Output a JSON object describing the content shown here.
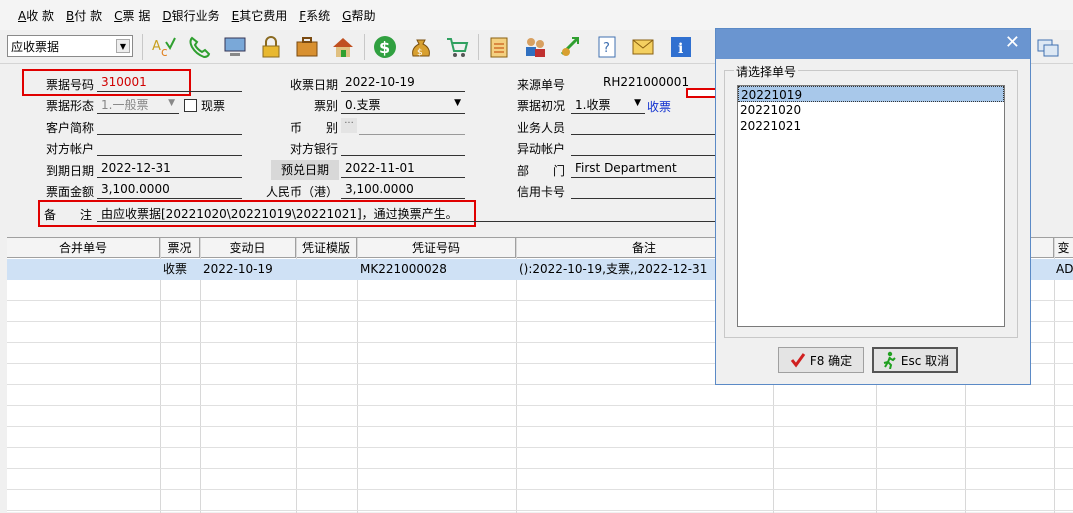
{
  "menu": [
    {
      "key": "A",
      "label": "收 款"
    },
    {
      "key": "B",
      "label": "付 款"
    },
    {
      "key": "C",
      "label": "票 据"
    },
    {
      "key": "D",
      "label": "银行业务"
    },
    {
      "key": "E",
      "label": "其它费用"
    },
    {
      "key": "F",
      "label": "系统"
    },
    {
      "key": "G",
      "label": "帮助"
    }
  ],
  "toolbar": {
    "combo_value": "应收票据"
  },
  "form": {
    "bill_no_label": "票据号码",
    "bill_no": "310001",
    "bill_form_label": "票据形态",
    "bill_form": "1.一般票",
    "cash_label": "现票",
    "customer_label": "客户简称",
    "customer": "",
    "counter_acct_label": "对方帐户",
    "counter_acct": "",
    "due_date_label": "到期日期",
    "due_date": "2022-12-31",
    "face_amount_label": "票面金额",
    "face_amount": "3,100.0000",
    "remark_label": "备　　注",
    "remark": "由应收票据[20221020\\20221019\\20221021]，通过换票产生。",
    "recv_date_label": "收票日期",
    "recv_date": "2022-10-19",
    "bill_type_label": "票别",
    "bill_type": "0.支票",
    "currency_label": "币　　别",
    "currency": "",
    "counter_bank_label": "对方银行",
    "counter_bank": "",
    "pre_cash_label": "预兑日期",
    "pre_cash_date": "2022-11-01",
    "rmb_label": "人民币（港）",
    "rmb": "3,100.0000",
    "source_no_label": "来源单号",
    "source_no": "RH221000001",
    "bill_init_label": "票据初况",
    "bill_init": "1.收票",
    "bill_init_link": "收票",
    "sales_label": "业务人员",
    "sales": "",
    "change_acct_label": "异动帐户",
    "change_acct": "",
    "dept_label": "部　　门",
    "dept": "First Department",
    "card_label": "信用卡号",
    "card": ""
  },
  "grid": {
    "headers": [
      "合并单号",
      "票况",
      "变动日",
      "凭证模版",
      "凭证号码",
      "备注",
      "",
      "",
      "",
      "变"
    ],
    "rows": [
      {
        "merge_no": "",
        "status": "收票",
        "change_date": "2022-10-19",
        "template": "",
        "voucher_no": "MK221000028",
        "remark": "():2022-10-19,支票,,2022-12-31",
        "extra": "AD"
      }
    ]
  },
  "dialog": {
    "group_label": "请选择单号",
    "items": [
      "20221019",
      "20221020",
      "20221021"
    ],
    "ok_label": "F8 确定",
    "cancel_label": "Esc 取消",
    "close": "✕"
  },
  "colors": {
    "accent_red": "#e00000",
    "title_blue": "#6a95d0",
    "select_blue": "#a8c8ea",
    "row_select": "#cfe1f5"
  }
}
